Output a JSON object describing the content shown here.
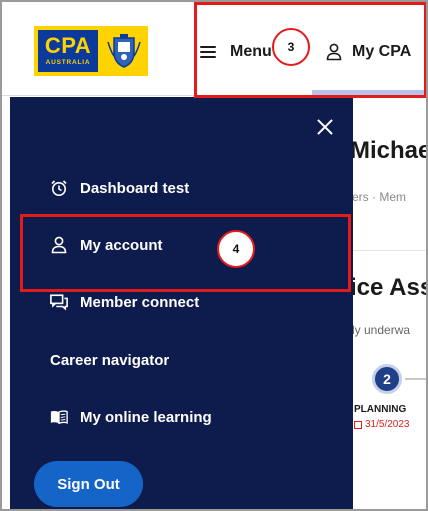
{
  "header": {
    "logo": {
      "name": "CPA",
      "subtitle": "AUSTRALIA"
    },
    "menu_label": "Menu",
    "my_cpa_label": "My CPA"
  },
  "drawer": {
    "items": [
      {
        "label": "Dashboard test",
        "icon": "alarm-clock-icon"
      },
      {
        "label": "My account",
        "icon": "person-icon"
      },
      {
        "label": "Member connect",
        "icon": "chat-icon"
      },
      {
        "label": "Career navigator",
        "icon": ""
      },
      {
        "label": "My online learning",
        "icon": "book-icon"
      }
    ],
    "sign_out_label": "Sign Out"
  },
  "background_page": {
    "title": "Michae",
    "breadcrumb": "ers  ·  Mem",
    "heading": "ice Ass",
    "text": "ly underwa",
    "step": {
      "number": "2",
      "label": "PLANNING",
      "date": "31/5/2023"
    }
  },
  "annotations": [
    {
      "number": "3"
    },
    {
      "number": "4"
    }
  ],
  "colors": {
    "drawer_bg": "#0e1b4d",
    "brand_yellow": "#ffd300",
    "brand_blue": "#0b3a9a",
    "sign_out_blue": "#1565c8",
    "annotation_red": "#e41b1b"
  }
}
